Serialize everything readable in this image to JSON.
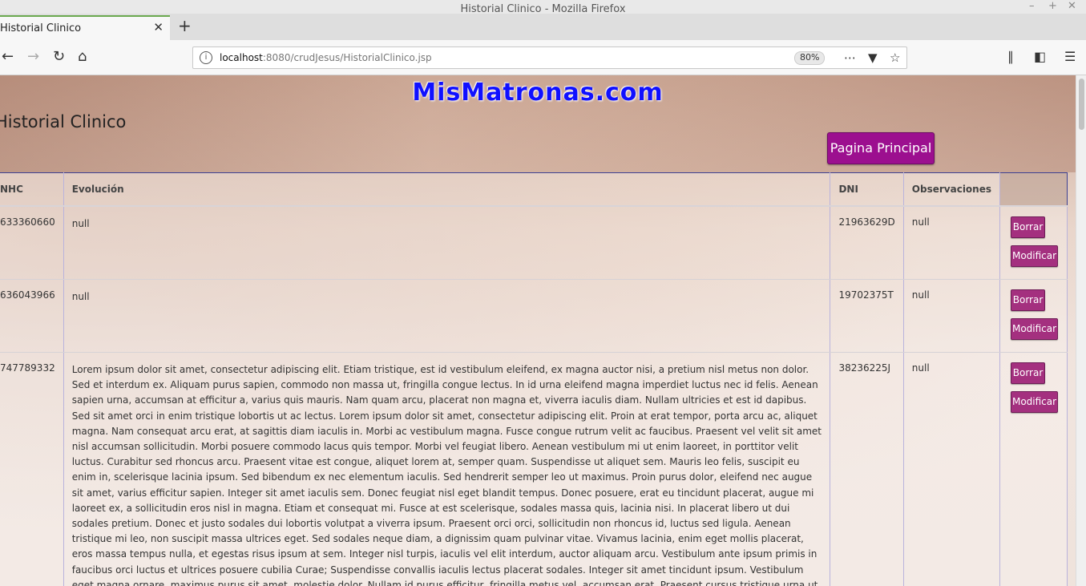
{
  "window": {
    "title": "Historial Clinico - Mozilla Firefox"
  },
  "tab": {
    "label": "Historial Clinico"
  },
  "nav": {
    "url_host": "localhost",
    "url_path": ":8080/crudJesus/HistorialClinico.jsp",
    "zoom": "80%"
  },
  "page": {
    "brand": "MisMatronas.com",
    "title": "Historial Clinico",
    "home_button": "Pagina Principal"
  },
  "table": {
    "headers": {
      "nhc": "NHC",
      "evolucion": "Evolución",
      "dni": "DNI",
      "obs": "Observaciones"
    },
    "delete_label": "Borrar",
    "modify_label": "Modificar",
    "rows": [
      {
        "nhc": "633360660",
        "evolucion": "null",
        "dni": "21963629D",
        "obs": "null"
      },
      {
        "nhc": "636043966",
        "evolucion": "null",
        "dni": "19702375T",
        "obs": "null"
      },
      {
        "nhc": "747789332",
        "evolucion": "Lorem ipsum dolor sit amet, consectetur adipiscing elit. Etiam tristique, est id vestibulum eleifend, ex magna auctor nisi, a pretium nisl metus non dolor. Sed et interdum ex. Aliquam purus sapien, commodo non massa ut, fringilla congue lectus. In id urna eleifend magna imperdiet luctus nec id felis. Aenean sapien urna, accumsan at efficitur a, varius quis mauris. Nam quam arcu, placerat non magna et, viverra iaculis diam. Nullam ultricies et est id dapibus. Sed sit amet orci in enim tristique lobortis ut ac lectus. Lorem ipsum dolor sit amet, consectetur adipiscing elit. Proin at erat tempor, porta arcu ac, aliquet magna. Nam consequat arcu erat, at sagittis diam iaculis in. Morbi ac vestibulum magna. Fusce congue rutrum velit ac faucibus. Praesent vel velit sit amet nisl accumsan sollicitudin. Morbi posuere commodo lacus quis tempor. Morbi vel feugiat libero. Aenean vestibulum mi ut enim laoreet, in porttitor velit luctus. Curabitur sed rhoncus arcu. Praesent vitae est congue, aliquet lorem at, semper quam. Suspendisse ut aliquet sem. Mauris leo felis, suscipit eu enim in, scelerisque lacinia ipsum. Sed bibendum ex nec elementum iaculis. Sed hendrerit semper leo ut maximus. Proin purus dolor, eleifend nec augue sit amet, varius efficitur sapien. Integer sit amet iaculis sem. Donec feugiat nisl eget blandit tempus. Donec posuere, erat eu tincidunt placerat, augue mi laoreet ex, a sollicitudin eros nisl in magna. Etiam et consequat mi. Fusce at est scelerisque, sodales massa quis, lacinia nisi. In placerat libero ut dui sodales pretium. Donec et justo sodales dui lobortis volutpat a viverra ipsum. Praesent orci orci, sollicitudin non rhoncus id, luctus sed ligula. Aenean tristique mi leo, non suscipit massa ultrices eget. Sed sodales neque diam, a dignissim quam pulvinar vitae. Vivamus lacinia, enim eget mollis placerat, eros massa tempus nulla, et egestas risus ipsum at sem. Integer nisl turpis, iaculis vel elit interdum, auctor aliquam arcu. Vestibulum ante ipsum primis in faucibus orci luctus et ultrices posuere cubilia Curae; Suspendisse convallis iaculis lectus placerat sodales. Integer sit amet tincidunt ipsum. Vestibulum eget magna ornare, maximus purus sit amet, molestie dolor. Nullam id purus efficitur, fringilla metus vel, accumsan erat. Praesent cursus tristique urna ut suscipit. Sed at pharetra tortor. Curabitur porta lacus sit amet elit cursus accumsan. Duis et mi egestas, pellentesque sapien eget, accumsan enim. Nam",
        "dni": "38236225J",
        "obs": "null"
      }
    ]
  },
  "colors": {
    "brand_text": "#1010ff",
    "home_button_bg": "#9c0f8f",
    "action_button_bg": "#a4307f"
  }
}
